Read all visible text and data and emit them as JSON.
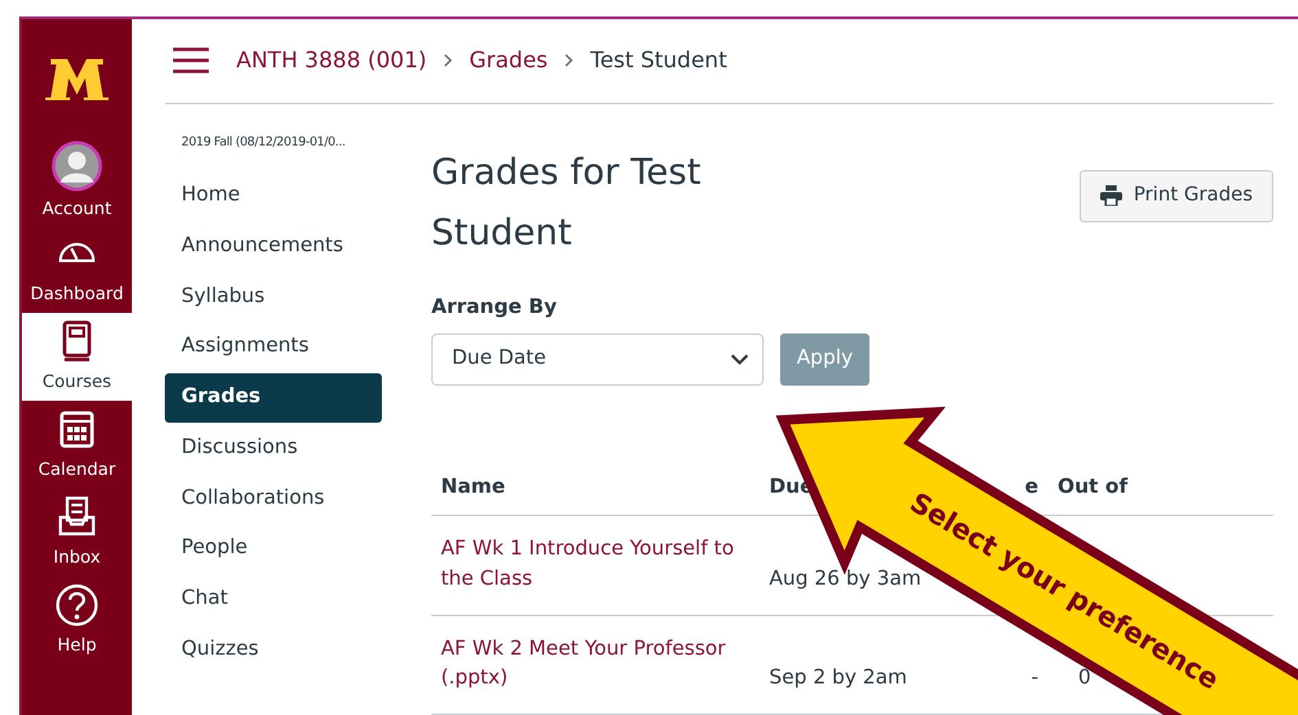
{
  "global_nav": {
    "items": [
      {
        "label": "Account",
        "kind": "account",
        "selected": false
      },
      {
        "label": "Dashboard",
        "kind": "dashboard",
        "selected": false
      },
      {
        "label": "Courses",
        "kind": "courses",
        "selected": true
      },
      {
        "label": "Calendar",
        "kind": "calendar",
        "selected": false
      },
      {
        "label": "Inbox",
        "kind": "inbox",
        "selected": false
      },
      {
        "label": "Help",
        "kind": "help",
        "selected": false
      }
    ]
  },
  "breadcrumbs": [
    "ANTH 3888 (001)",
    "Grades",
    "Test Student"
  ],
  "course_nav": {
    "term": "2019 Fall (08/12/2019-01/0...",
    "items": [
      {
        "label": "Home",
        "selected": false
      },
      {
        "label": "Announcements",
        "selected": false
      },
      {
        "label": "Syllabus",
        "selected": false
      },
      {
        "label": "Assignments",
        "selected": false
      },
      {
        "label": "Grades",
        "selected": true
      },
      {
        "label": "Discussions",
        "selected": false
      },
      {
        "label": "Collaborations",
        "selected": false
      },
      {
        "label": "People",
        "selected": false
      },
      {
        "label": "Chat",
        "selected": false
      },
      {
        "label": "Quizzes",
        "selected": false
      }
    ]
  },
  "page": {
    "title": "Grades for Test Student",
    "print_button": "Print Grades",
    "arrange_label": "Arrange By",
    "arrange_select": "Due Date",
    "apply_button": "Apply"
  },
  "table": {
    "columns": [
      "Name",
      "Due",
      "e",
      "Out of"
    ],
    "rows": [
      {
        "name": "AF Wk 1 Introduce Yourself to the Class",
        "due": "Aug 26 by 3am"
      },
      {
        "name": "AF Wk 2 Meet Your Professor (.pptx)",
        "due": "Sep 2 by 2am",
        "score": "-",
        "out_of": "0"
      }
    ]
  },
  "callout": {
    "text": "Select your preference"
  }
}
